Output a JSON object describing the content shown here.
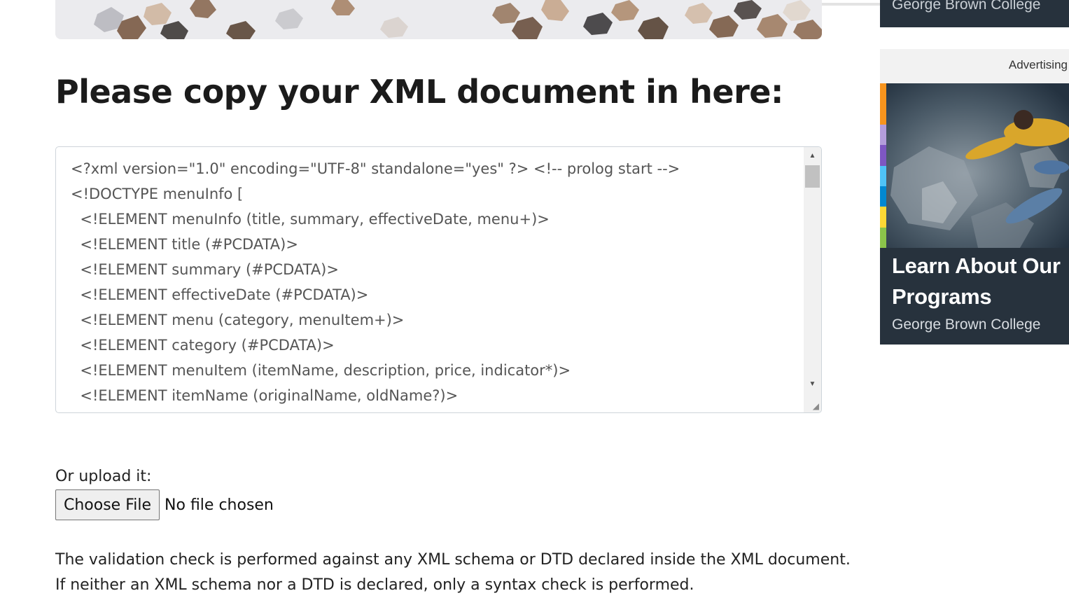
{
  "heading": "Please copy your XML document in here:",
  "xml_lines": [
    "<?xml version=\"1.0\" encoding=\"UTF-8\" standalone=\"yes\" ?> <!-- prolog start -->",
    "<!DOCTYPE menuInfo [",
    "  <!ELEMENT menuInfo (title, summary, effectiveDate, menu+)>",
    "  <!ELEMENT title (#PCDATA)>",
    "  <!ELEMENT summary (#PCDATA)>",
    "  <!ELEMENT effectiveDate (#PCDATA)>",
    "  <!ELEMENT menu (category, menuItem+)>",
    "  <!ELEMENT category (#PCDATA)>",
    "  <!ELEMENT menuItem (itemName, description, price, indicator*)>",
    "  <!ELEMENT itemName (originalName, oldName?)>"
  ],
  "upload": {
    "label": "Or upload it:",
    "button_label": "Choose File",
    "status": "No file chosen"
  },
  "info": {
    "line1": "The validation check is performed against any XML schema or DTD declared inside the XML document.",
    "line2": "If neither an XML schema nor a DTD is declared, only a syntax check is performed."
  },
  "sidebar": {
    "top_card_text": "George Brown College",
    "ad_label": "Advertising",
    "ad_title": "Learn About Our Programs",
    "ad_subtitle": "George Brown College",
    "stripe_colors": [
      "#f7941d",
      "#f7941d",
      "#b39ddb",
      "#7e57c2",
      "#4fc3f7",
      "#0288d1",
      "#fdd835",
      "#8bc34a"
    ]
  },
  "scrollbar": {
    "up_icon": "triangle-up-icon",
    "down_icon": "triangle-down-icon",
    "resize_icon": "resize-grip-icon"
  }
}
